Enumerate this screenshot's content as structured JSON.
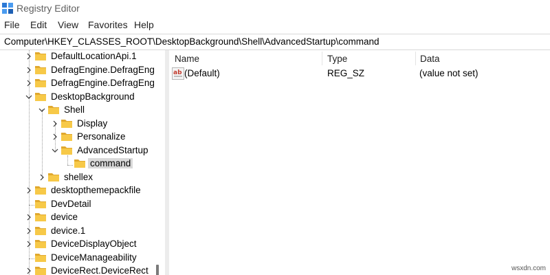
{
  "window": {
    "title": "Registry Editor"
  },
  "menu": {
    "file": "File",
    "edit": "Edit",
    "view": "View",
    "favorites": "Favorites",
    "help": "Help"
  },
  "address": {
    "path": "Computer\\HKEY_CLASSES_ROOT\\DesktopBackground\\Shell\\AdvancedStartup\\command"
  },
  "tree": {
    "items": [
      {
        "label": "DefaultLocationApi.1",
        "expander": "chevron-right"
      },
      {
        "label": "DefragEngine.DefragEng",
        "expander": "chevron-right"
      },
      {
        "label": "DefragEngine.DefragEng",
        "expander": "chevron-right"
      },
      {
        "label": "DesktopBackground",
        "expander": "chevron-down"
      },
      {
        "label": "Shell",
        "expander": "chevron-down"
      },
      {
        "label": "Display",
        "expander": "chevron-right"
      },
      {
        "label": "Personalize",
        "expander": "chevron-right"
      },
      {
        "label": "AdvancedStartup",
        "expander": "chevron-down"
      },
      {
        "label": "command",
        "expander": "none",
        "selected": true
      },
      {
        "label": "shellex",
        "expander": "chevron-right"
      },
      {
        "label": "desktopthemepackfile",
        "expander": "chevron-right"
      },
      {
        "label": "DevDetail",
        "expander": "none"
      },
      {
        "label": "device",
        "expander": "chevron-right"
      },
      {
        "label": "device.1",
        "expander": "chevron-right"
      },
      {
        "label": "DeviceDisplayObject",
        "expander": "chevron-right"
      },
      {
        "label": "DeviceManageability",
        "expander": "none"
      },
      {
        "label": "DeviceRect.DeviceRect",
        "expander": "chevron-right"
      }
    ]
  },
  "list": {
    "columns": {
      "name": "Name",
      "type": "Type",
      "data": "Data"
    },
    "rows": [
      {
        "name": "(Default)",
        "type": "REG_SZ",
        "data": "(value not set)",
        "icon": "string-value-icon"
      }
    ]
  },
  "watermark": "wsxdn.com",
  "colors": {
    "folder": "#f7c948",
    "folder_dark": "#e0a82e",
    "selection": "#d9d9d9",
    "ab_icon": "#c0392b"
  }
}
